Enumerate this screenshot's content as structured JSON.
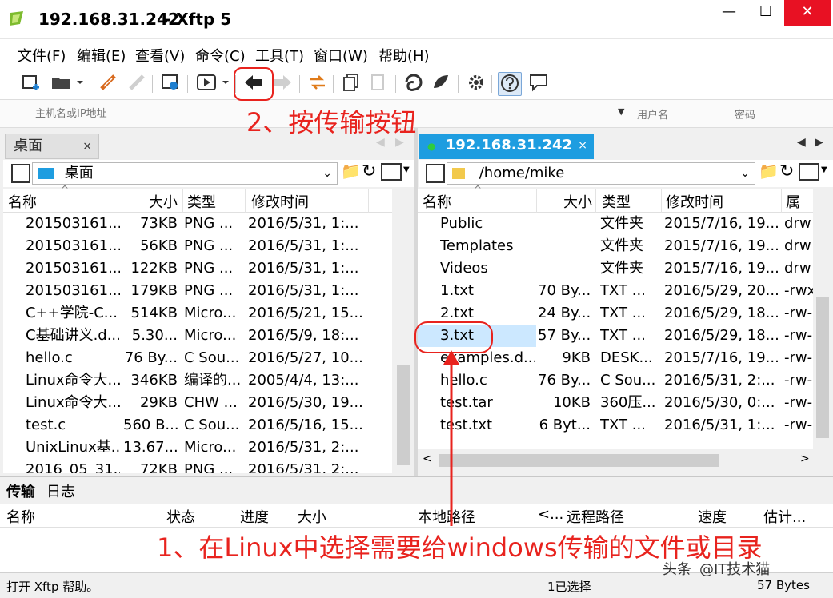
{
  "window": {
    "host": "192.168.31.242",
    "app": "- Xftp 5",
    "minimize": "—",
    "maximize": "☐",
    "close": "✕"
  },
  "menu": [
    "文件(F)",
    "编辑(E)",
    "查看(V)",
    "命令(C)",
    "工具(T)",
    "窗口(W)",
    "帮助(H)"
  ],
  "address": {
    "host_placeholder": "主机名或IP地址",
    "user_placeholder": "用户名",
    "password_placeholder": "密码"
  },
  "left_pane": {
    "tab": "桌面",
    "path": "桌面",
    "columns": [
      "名称",
      "大小",
      "类型",
      "修改时间"
    ],
    "rows": [
      {
        "name": "201503161...",
        "size": "73KB",
        "type": "PNG ...",
        "modified": "2016/5/31, 1:...",
        "icon": "png-icon"
      },
      {
        "name": "201503161...",
        "size": "56KB",
        "type": "PNG ...",
        "modified": "2016/5/31, 1:...",
        "icon": "png-icon"
      },
      {
        "name": "201503161...",
        "size": "122KB",
        "type": "PNG ...",
        "modified": "2016/5/31, 1:...",
        "icon": "png-icon"
      },
      {
        "name": "201503161...",
        "size": "179KB",
        "type": "PNG ...",
        "modified": "2016/5/31, 1:...",
        "icon": "png-icon"
      },
      {
        "name": "C++学院-C...",
        "size": "514KB",
        "type": "Micro...",
        "modified": "2016/5/21, 15...",
        "icon": "doc-icon"
      },
      {
        "name": "C基础讲义.d...",
        "size": "5.30...",
        "type": "Micro...",
        "modified": "2016/5/9, 18:...",
        "icon": "doc-icon"
      },
      {
        "name": "hello.c",
        "size": "76 By...",
        "type": "C Sou...",
        "modified": "2016/5/27, 10...",
        "icon": "c-file-icon"
      },
      {
        "name": "Linux命令大...",
        "size": "346KB",
        "type": "编译的...",
        "modified": "2005/4/4, 13:...",
        "icon": "help-file-icon"
      },
      {
        "name": "Linux命令大...",
        "size": "29KB",
        "type": "CHW ...",
        "modified": "2016/5/30, 19...",
        "icon": "blank-file-icon"
      },
      {
        "name": "test.c",
        "size": "560 B...",
        "type": "C Sou...",
        "modified": "2016/5/16, 15...",
        "icon": "c-file-icon"
      },
      {
        "name": "UnixLinux基...",
        "size": "13.67...",
        "type": "Micro...",
        "modified": "2016/5/31, 2:...",
        "icon": "doc-icon"
      },
      {
        "name": "2016_05_31...",
        "size": "72KB",
        "type": "PNG ...",
        "modified": "2016/5/31, 2:...",
        "icon": "png-icon"
      }
    ]
  },
  "right_pane": {
    "tab": "192.168.31.242",
    "path": "/home/mike",
    "columns": [
      "名称",
      "大小",
      "类型",
      "修改时间",
      "属性"
    ],
    "rows": [
      {
        "name": "Public",
        "size": "",
        "type": "文件夹",
        "modified": "2015/7/16, 19...",
        "attr": "drw",
        "icon": "folder-icon"
      },
      {
        "name": "Templates",
        "size": "",
        "type": "文件夹",
        "modified": "2015/7/16, 19...",
        "attr": "drw",
        "icon": "folder-icon"
      },
      {
        "name": "Videos",
        "size": "",
        "type": "文件夹",
        "modified": "2015/7/16, 19...",
        "attr": "drw",
        "icon": "folder-icon"
      },
      {
        "name": "1.txt",
        "size": "70 By...",
        "type": "TXT ...",
        "modified": "2016/5/29, 20...",
        "attr": "-rwx",
        "icon": "txt-file-icon"
      },
      {
        "name": "2.txt",
        "size": "24 By...",
        "type": "TXT ...",
        "modified": "2016/5/29, 18...",
        "attr": "-rw-",
        "icon": "txt-file-icon"
      },
      {
        "name": "3.txt",
        "size": "57 By...",
        "type": "TXT ...",
        "modified": "2016/5/29, 18...",
        "attr": "-rw-",
        "icon": "txt-file-icon",
        "selected": true
      },
      {
        "name": "examples.d...",
        "size": "9KB",
        "type": "DESK...",
        "modified": "2015/7/16, 19...",
        "attr": "-rw-",
        "icon": "blank-file-icon"
      },
      {
        "name": "hello.c",
        "size": "76 By...",
        "type": "C Sou...",
        "modified": "2016/5/31, 2:...",
        "attr": "-rw-",
        "icon": "c-file-icon"
      },
      {
        "name": "test.tar",
        "size": "10KB",
        "type": "360压...",
        "modified": "2016/5/30, 0:...",
        "attr": "-rw-",
        "icon": "archive-icon"
      },
      {
        "name": "test.txt",
        "size": "6 Byt...",
        "type": "TXT ...",
        "modified": "2016/5/31, 1:...",
        "attr": "-rw-",
        "icon": "txt-file-icon"
      }
    ]
  },
  "transfer": {
    "tabs": [
      "传输",
      "日志"
    ],
    "columns": [
      "名称",
      "状态",
      "进度",
      "大小",
      "本地路径",
      "<...",
      "远程路径",
      "速度",
      "估计..."
    ]
  },
  "status": {
    "left": "打开 Xftp 帮助。",
    "selected": "1已选择",
    "size": "57 Bytes"
  },
  "annotations": {
    "step2": "2、按传输按钮",
    "step1": "1、在Linux中选择需要给windows传输的文件或目录",
    "watermark": "头条",
    "watermark_handle": "@IT技术猫"
  },
  "colors": {
    "accent_tab": "#1e9de0",
    "annotation_red": "#e8231e",
    "selection": "#cce8ff",
    "close_button": "#e81123"
  }
}
